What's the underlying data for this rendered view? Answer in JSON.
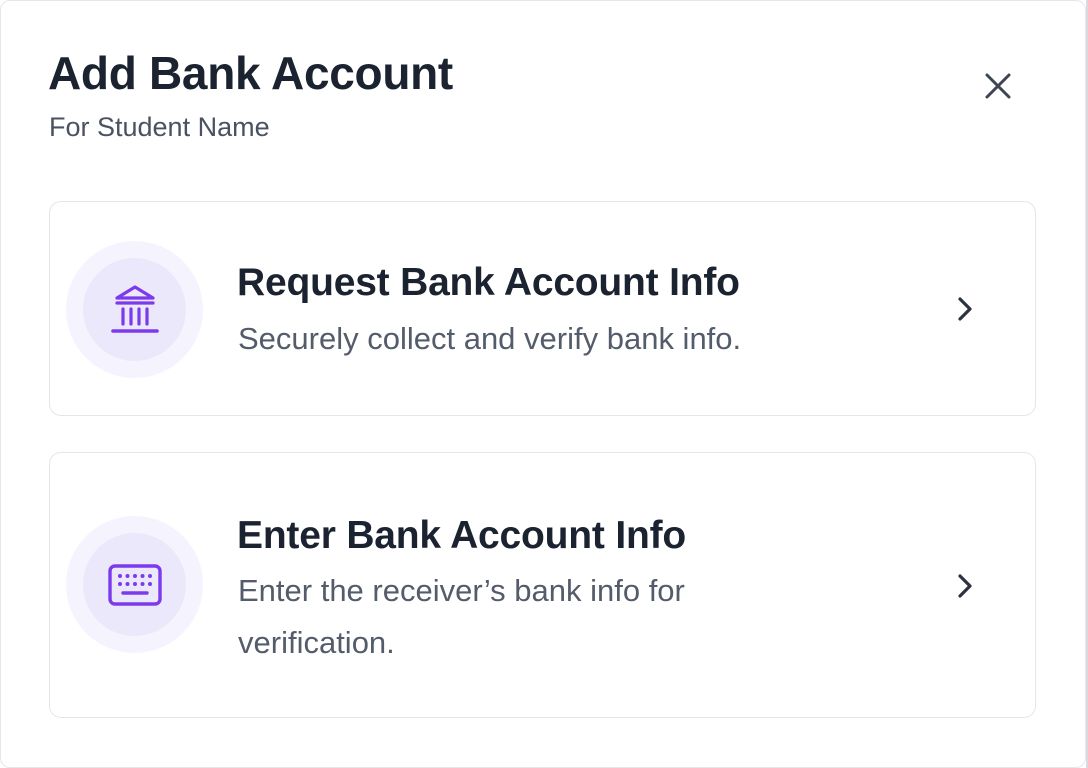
{
  "dialog": {
    "title": "Add Bank Account",
    "subtitle": "For Student Name",
    "close_icon": "close-icon"
  },
  "options": [
    {
      "title": "Request Bank Account Info",
      "description": "Securely collect and verify bank info.",
      "icon": "bank-icon",
      "action_icon": "chevron-right-icon"
    },
    {
      "title": "Enter Bank Account Info",
      "description": "Enter the receiver’s bank info for verification.",
      "icon": "keyboard-icon",
      "action_icon": "chevron-right-icon"
    }
  ],
  "colors": {
    "accent": "#7c3aed",
    "icon_ring": "#f5f3fd",
    "icon_inner": "#ece8fb",
    "text_primary": "#1b2230",
    "text_secondary": "#545c6b",
    "card_border": "#e4e6ea"
  }
}
